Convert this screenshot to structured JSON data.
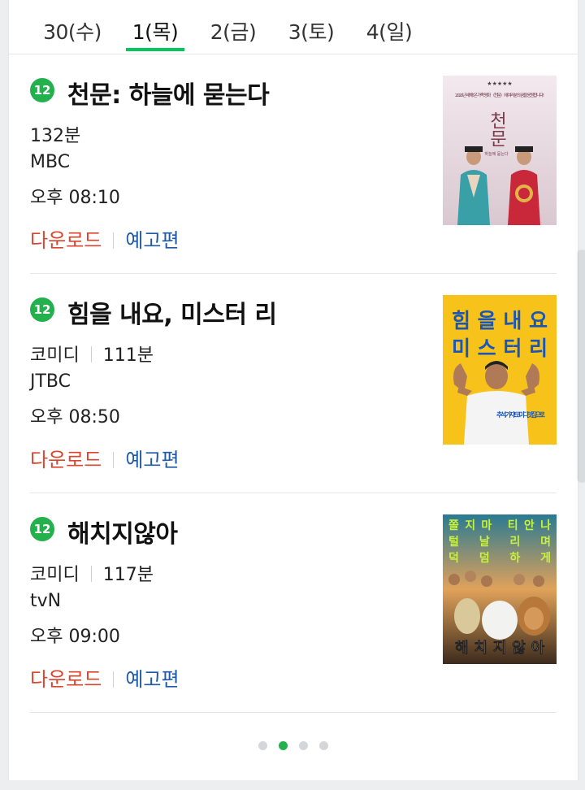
{
  "tabs": [
    {
      "label": "30(수)"
    },
    {
      "label": "1(목)"
    },
    {
      "label": "2(금)"
    },
    {
      "label": "3(토)"
    },
    {
      "label": "4(일)"
    }
  ],
  "active_tab": 1,
  "colors": {
    "accent_green": "#03c75a",
    "download_red": "#d9452f",
    "trailer_blue": "#1e5aa8"
  },
  "movies": [
    {
      "rating": "12",
      "title": "천문: 하늘에 묻는다",
      "genre": "",
      "runtime": "132분",
      "channel": "MBC",
      "time": "오후 08:10",
      "download_label": "다운로드",
      "trailer_label": "예고편",
      "poster": {
        "stars": "★★★★★",
        "top_text": "2020년 새해! 온 가족 명화 〈천문〉에 여러분의 꿈을 응원합니다!",
        "big_text": "천문",
        "sub_text": "하늘에 묻는다"
      }
    },
    {
      "rating": "12",
      "title": "힘을 내요, 미스터 리",
      "genre": "코미디",
      "runtime": "111분",
      "channel": "JTBC",
      "time": "오후 08:50",
      "download_label": "다운로드",
      "trailer_label": "예고편",
      "poster": {
        "big_text_1": "힘을내요",
        "big_text_2": "미스터리",
        "slogan": "추석, 가자! 코미디 맛집으로"
      }
    },
    {
      "rating": "12",
      "title": "해치지않아",
      "genre": "코미디",
      "runtime": "117분",
      "channel": "tvN",
      "time": "오후 09:00",
      "download_label": "다운로드",
      "trailer_label": "예고편",
      "poster": {
        "line1": "쫄지마 티안나",
        "line2": "털 날 리 며",
        "line3": "덕 덤 하 게",
        "big_text": "해치지않아"
      }
    }
  ],
  "pagination": {
    "current": 2,
    "total": 4
  }
}
